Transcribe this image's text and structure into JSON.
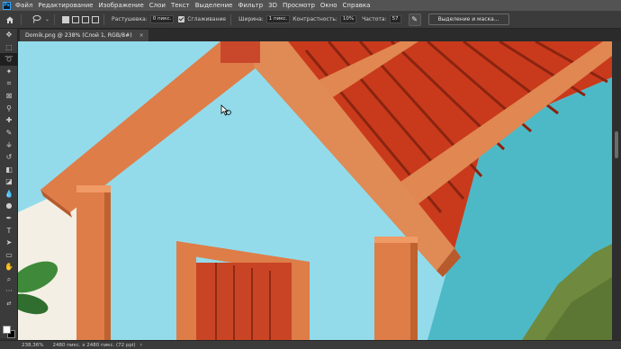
{
  "app": {
    "logo": "Ps"
  },
  "menu": [
    "Файл",
    "Редактирование",
    "Изображение",
    "Слои",
    "Текст",
    "Выделение",
    "Фильтр",
    "3D",
    "Просмотр",
    "Окно",
    "Справка"
  ],
  "options": {
    "feather_label": "Растушевка:",
    "feather_value": "0 пикс.",
    "antialias_label": "Сглаживание",
    "width_label": "Ширина:",
    "width_value": "1 пикс.",
    "contrast_label": "Контрастность:",
    "contrast_value": "10%",
    "frequency_label": "Частота:",
    "frequency_value": "57",
    "mask_button": "Выделение и маска..."
  },
  "document": {
    "tab_title": "Domik.png @ 238% (Слой 1, RGB/8#)",
    "close": "×"
  },
  "status": {
    "zoom": "238,36%",
    "doc_info": "2480 пикс. x 2480 пикс. (72 ppi)",
    "arrow": "›"
  },
  "icons": {
    "home": "home-icon",
    "tool_preset": "magnetic-lasso-icon",
    "brush_settings": "pen-pressure-icon"
  },
  "colors": {
    "wall": "#93dbea",
    "trim": "#de7d48",
    "roof": "#c93a1c",
    "door": "#c94424",
    "foreground_swatch": "#ffffff",
    "background_swatch": "#000000"
  }
}
